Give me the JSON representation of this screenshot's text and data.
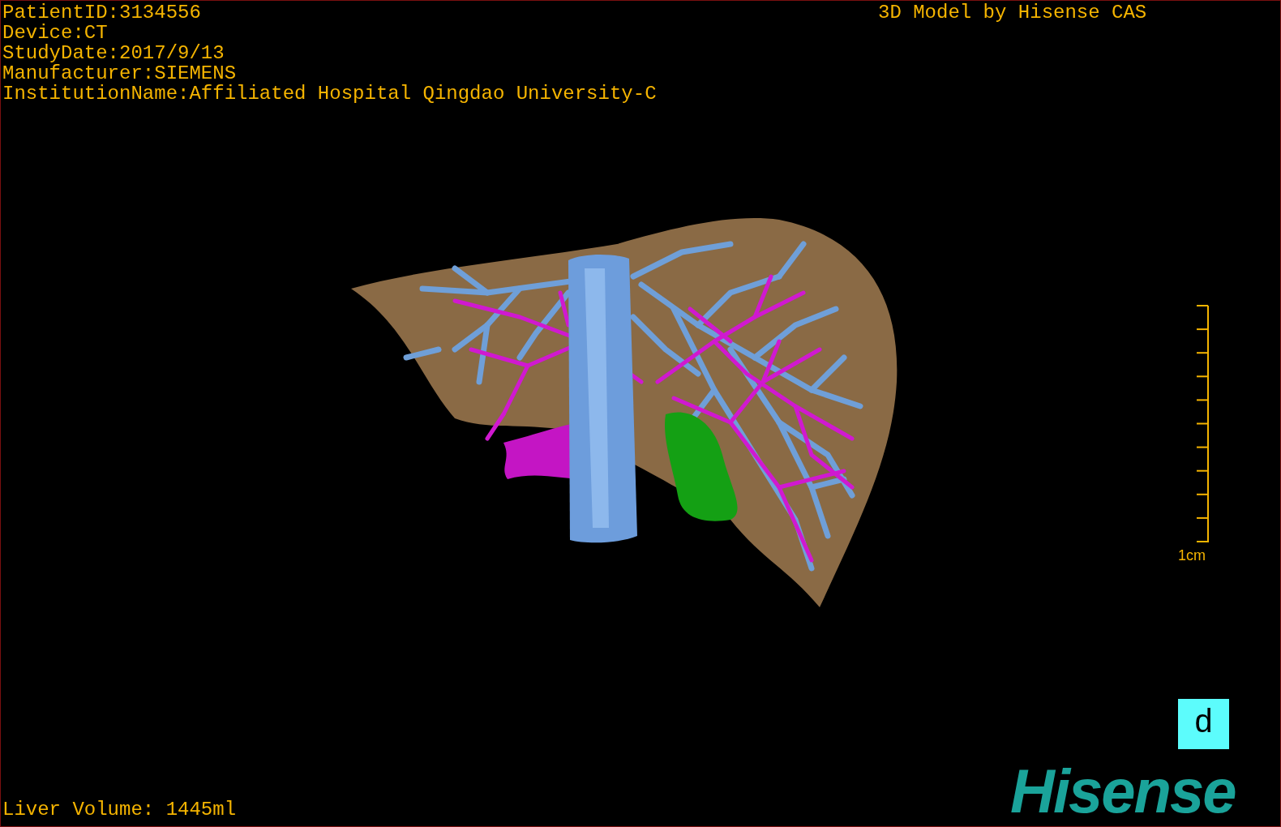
{
  "patient_info": [
    "PatientID:3134556",
    "Device:CT",
    "StudyDate:2017/9/13",
    "Manufacturer:SIEMENS",
    "InstitutionName:Affiliated Hospital Qingdao University-C"
  ],
  "credit": "3D Model by Hisense CAS",
  "scale_label": "1cm",
  "view_button": "d",
  "liver_volume": "Liver Volume: 1445ml",
  "logo": "Hisense"
}
